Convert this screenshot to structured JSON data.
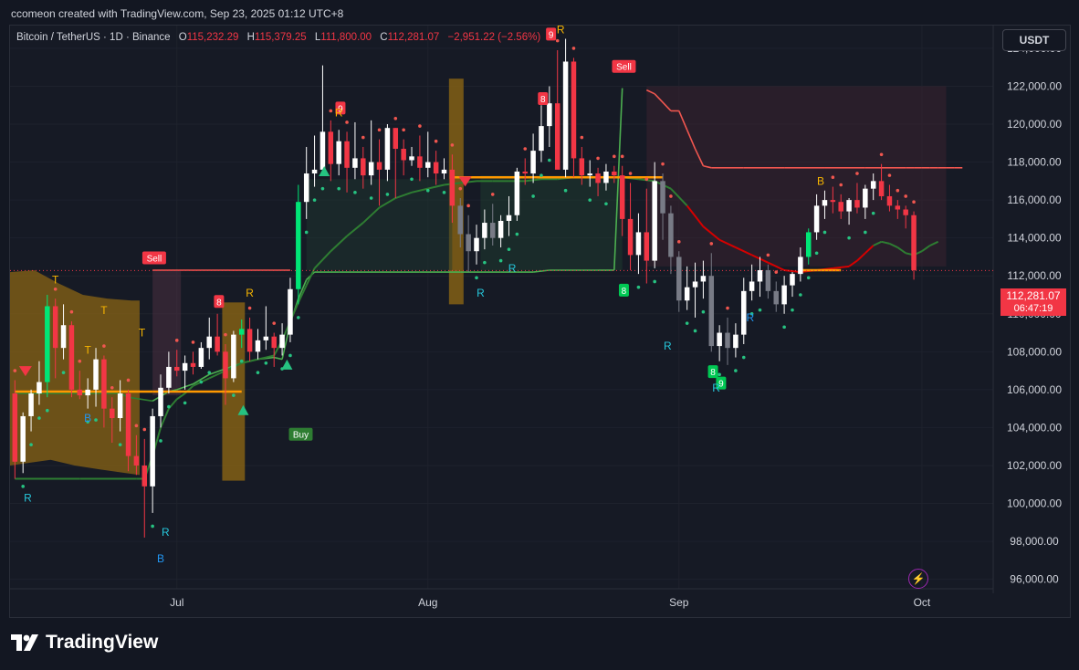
{
  "header": {
    "caption": "ccomeon created with TradingView.com, Sep 23, 2025 01:12 UTC+8",
    "symbol_line": "Bitcoin / TetherUS · 1D · Binance",
    "ohlc": {
      "o_label": "O",
      "o": "115,232.29",
      "h_label": "H",
      "h": "115,379.25",
      "l_label": "L",
      "l": "111,800.00",
      "c_label": "C",
      "c": "112,281.07",
      "change": "−2,951.22 (−2.56%)"
    }
  },
  "currency_button": "USDT",
  "last_price": {
    "price": "112,281.07",
    "countdown": "06:47:19"
  },
  "brand": {
    "name": "TradingView"
  },
  "colors": {
    "up": "#ffffff",
    "up_strong": "#00e676",
    "down": "#f23645",
    "gray": "#787b86",
    "trend_up": "#2e7d32",
    "trend_down": "#d50000",
    "orange": "#ff9800",
    "band": "#8a6414"
  },
  "chart_data": {
    "type": "candlestick",
    "symbol": "Bitcoin / TetherUS",
    "interval": "1D",
    "exchange": "Binance",
    "y_axis": {
      "ticks": [
        "96,000.00",
        "98,000.00",
        "100,000.00",
        "102,000.00",
        "104,000.00",
        "106,000.00",
        "108,000.00",
        "110,000.00",
        "112,000.00",
        "114,000.00",
        "116,000.00",
        "118,000.00",
        "120,000.00",
        "122,000.00",
        "124,000.00"
      ],
      "tick_values": [
        96000,
        98000,
        100000,
        102000,
        104000,
        106000,
        108000,
        110000,
        112000,
        114000,
        116000,
        118000,
        120000,
        122000,
        124000
      ],
      "range": [
        95500,
        125200
      ]
    },
    "x_axis": {
      "labels": [
        "Jul",
        "Aug",
        "Sep",
        "Oct"
      ],
      "label_index": [
        20,
        51,
        82,
        112
      ],
      "range": [
        -0.6,
        120.8
      ]
    },
    "candles": [
      [
        105800,
        106500,
        101300,
        102200
      ],
      [
        102200,
        104800,
        101600,
        104600
      ],
      [
        104600,
        106000,
        103800,
        105800
      ],
      [
        105800,
        107500,
        105200,
        106400
      ],
      [
        106400,
        111000,
        105600,
        110400
      ],
      [
        110400,
        110800,
        106600,
        108200
      ],
      [
        108200,
        110500,
        107600,
        109400
      ],
      [
        109400,
        109600,
        105600,
        106000
      ],
      [
        106000,
        107000,
        105500,
        105700
      ],
      [
        105700,
        106600,
        105000,
        106000
      ],
      [
        106000,
        108200,
        105100,
        107600
      ],
      [
        107600,
        107800,
        104000,
        105000
      ],
      [
        105000,
        105600,
        103200,
        104500
      ],
      [
        104500,
        106500,
        103800,
        105800
      ],
      [
        105800,
        106000,
        101700,
        102500
      ],
      [
        102500,
        103600,
        101500,
        102000
      ],
      [
        102000,
        103400,
        98200,
        100900
      ],
      [
        100900,
        105000,
        99500,
        104600
      ],
      [
        104600,
        106800,
        104000,
        106100
      ],
      [
        106100,
        108000,
        105800,
        107200
      ],
      [
        107200,
        108100,
        106700,
        107000
      ],
      [
        107000,
        107800,
        106000,
        107400
      ],
      [
        107400,
        108000,
        106800,
        107200
      ],
      [
        107200,
        108500,
        107100,
        108200
      ],
      [
        108200,
        109800,
        107600,
        108800
      ],
      [
        108800,
        110000,
        107800,
        108000
      ],
      [
        108000,
        108400,
        105200,
        106600
      ],
      [
        106600,
        109100,
        106400,
        108900
      ],
      [
        108900,
        109700,
        108200,
        109200
      ],
      [
        109200,
        109800,
        107500,
        108000
      ],
      [
        108000,
        109200,
        107600,
        108600
      ],
      [
        108600,
        110400,
        108100,
        108800
      ],
      [
        108800,
        109000,
        107200,
        108200
      ],
      [
        108200,
        109500,
        107800,
        108900
      ],
      [
        108900,
        111900,
        108500,
        111300
      ],
      [
        111300,
        116800,
        110500,
        115900
      ],
      [
        115900,
        118800,
        115000,
        117400
      ],
      [
        117400,
        119400,
        116700,
        117600
      ],
      [
        117600,
        123100,
        117300,
        119600
      ],
      [
        119600,
        120200,
        117000,
        117900
      ],
      [
        117900,
        119700,
        117300,
        119100
      ],
      [
        119100,
        119600,
        116400,
        117700
      ],
      [
        117700,
        120100,
        117100,
        118200
      ],
      [
        118200,
        118800,
        116600,
        117300
      ],
      [
        117300,
        120200,
        116800,
        118000
      ],
      [
        118000,
        119200,
        115700,
        117600
      ],
      [
        117600,
        120000,
        117000,
        119800
      ],
      [
        119800,
        119800,
        116100,
        118700
      ],
      [
        118700,
        119200,
        117300,
        118100
      ],
      [
        118100,
        118800,
        117800,
        118300
      ],
      [
        118300,
        119400,
        117000,
        117700
      ],
      [
        117700,
        119600,
        117200,
        118000
      ],
      [
        118000,
        118600,
        116800,
        117400
      ],
      [
        117400,
        118200,
        117100,
        117600
      ],
      [
        117600,
        118400,
        114800,
        115700
      ],
      [
        115700,
        116100,
        113500,
        114200
      ],
      [
        114200,
        115200,
        112200,
        113300
      ],
      [
        113300,
        114700,
        112600,
        114000
      ],
      [
        114000,
        115500,
        113400,
        114800
      ],
      [
        114800,
        115800,
        113600,
        114000
      ],
      [
        114000,
        115200,
        113500,
        114900
      ],
      [
        114900,
        116200,
        114100,
        115200
      ],
      [
        115200,
        117700,
        114900,
        117500
      ],
      [
        117500,
        118200,
        116800,
        117400
      ],
      [
        117400,
        119500,
        116900,
        118600
      ],
      [
        118600,
        121000,
        118000,
        119900
      ],
      [
        119900,
        122000,
        118800,
        121100
      ],
      [
        121100,
        123900,
        117900,
        117600
      ],
      [
        117600,
        124500,
        117200,
        123300
      ],
      [
        123300,
        123500,
        117200,
        118200
      ],
      [
        118200,
        118800,
        116800,
        117300
      ],
      [
        117300,
        118100,
        116700,
        117400
      ],
      [
        117400,
        117700,
        116200,
        116900
      ],
      [
        116900,
        117900,
        116500,
        117500
      ],
      [
        117500,
        117800,
        116900,
        117300
      ],
      [
        117300,
        117800,
        114100,
        115000
      ],
      [
        115000,
        116900,
        112300,
        113100
      ],
      [
        113100,
        115300,
        112100,
        114300
      ],
      [
        114300,
        116600,
        111600,
        112800
      ],
      [
        112800,
        118000,
        112400,
        117000
      ],
      [
        117000,
        117400,
        113900,
        115300
      ],
      [
        115300,
        115700,
        112100,
        113000
      ],
      [
        113000,
        113300,
        110100,
        110700
      ],
      [
        110700,
        112500,
        110200,
        111400
      ],
      [
        111400,
        112700,
        109800,
        111700
      ],
      [
        111700,
        112800,
        110800,
        112000
      ],
      [
        112000,
        113200,
        108000,
        108300
      ],
      [
        108300,
        109400,
        107500,
        109000
      ],
      [
        109000,
        109800,
        107300,
        108200
      ],
      [
        108200,
        109500,
        107700,
        108900
      ],
      [
        108900,
        111900,
        108400,
        111200
      ],
      [
        111200,
        112600,
        110700,
        111700
      ],
      [
        111700,
        113000,
        110900,
        112300
      ],
      [
        112300,
        112600,
        110800,
        111200
      ],
      [
        111200,
        111700,
        110100,
        110500
      ],
      [
        110500,
        112000,
        110000,
        111500
      ],
      [
        111500,
        112200,
        110900,
        112100
      ],
      [
        112100,
        113500,
        111700,
        113000
      ],
      [
        113000,
        114500,
        112600,
        114300
      ],
      [
        114300,
        116300,
        113900,
        115700
      ],
      [
        115700,
        116500,
        115000,
        116000
      ],
      [
        116000,
        116700,
        115300,
        115900
      ],
      [
        115900,
        116300,
        115000,
        115400
      ],
      [
        115400,
        116100,
        114700,
        116000
      ],
      [
        116000,
        116900,
        115300,
        115600
      ],
      [
        115600,
        116800,
        115000,
        116600
      ],
      [
        116600,
        117400,
        116000,
        117000
      ],
      [
        117000,
        117900,
        116000,
        116200
      ],
      [
        116200,
        116800,
        115400,
        115700
      ],
      [
        115700,
        116000,
        115000,
        115500
      ],
      [
        115500,
        115700,
        114500,
        115200
      ],
      [
        115200,
        115400,
        111800,
        112300
      ]
    ],
    "supertrend": [
      [
        0,
        105800
      ],
      [
        3,
        105800
      ],
      [
        12,
        105800
      ],
      [
        13,
        105800
      ],
      [
        14,
        105600
      ],
      [
        17,
        105400
      ],
      [
        19,
        105900
      ],
      [
        20,
        106000
      ],
      [
        22,
        106300
      ],
      [
        24,
        106800
      ],
      [
        26,
        107100
      ],
      [
        28,
        107400
      ],
      [
        30,
        107600
      ],
      [
        32,
        107700
      ],
      [
        33,
        107600
      ],
      [
        34,
        109500
      ],
      [
        35,
        110800
      ],
      [
        36,
        111800
      ],
      [
        37,
        112200
      ],
      [
        40,
        112200
      ],
      [
        45,
        112200
      ],
      [
        50,
        112200
      ],
      [
        55,
        112200
      ],
      [
        60,
        112200
      ],
      [
        62,
        112200
      ],
      [
        64,
        112200
      ],
      [
        66,
        112300
      ],
      [
        70,
        112300
      ],
      [
        72,
        112300
      ],
      [
        73,
        112300
      ],
      [
        74,
        112300
      ],
      [
        75,
        121900
      ],
      [
        78,
        121800
      ],
      [
        79,
        121600
      ],
      [
        81,
        120700
      ],
      [
        82,
        120700
      ],
      [
        83,
        119700
      ],
      [
        84,
        118700
      ],
      [
        85,
        117800
      ],
      [
        86,
        117700
      ],
      [
        90,
        117700
      ],
      [
        95,
        117700
      ],
      [
        100,
        117700
      ],
      [
        105,
        117700
      ],
      [
        110,
        117700
      ],
      [
        111,
        117700
      ],
      [
        112,
        117700
      ],
      [
        113,
        117700
      ],
      [
        114,
        117700
      ],
      [
        115,
        117700
      ],
      [
        116,
        117700
      ],
      [
        117,
        117700
      ]
    ],
    "trend_line": [
      [
        0,
        101300
      ],
      [
        8,
        101300
      ],
      [
        15,
        101300
      ],
      [
        16,
        101300
      ],
      [
        17,
        102500
      ],
      [
        18,
        104000
      ],
      [
        19,
        105000
      ],
      [
        20,
        105500
      ],
      [
        21,
        105800
      ],
      [
        22,
        106200
      ],
      [
        24,
        106600
      ],
      [
        26,
        107000
      ],
      [
        28,
        107400
      ],
      [
        30,
        107600
      ],
      [
        31,
        107700
      ],
      [
        32,
        107800
      ],
      [
        33,
        108600
      ],
      [
        34,
        109600
      ],
      [
        35,
        110600
      ],
      [
        36,
        111500
      ],
      [
        37,
        112400
      ],
      [
        39,
        113300
      ],
      [
        41,
        114100
      ],
      [
        43,
        114800
      ],
      [
        45,
        115600
      ],
      [
        47,
        116100
      ],
      [
        49,
        116400
      ],
      [
        51,
        116600
      ],
      [
        53,
        116800
      ],
      [
        55,
        116900
      ],
      [
        57,
        117000
      ],
      [
        59,
        117000
      ],
      [
        61,
        117000
      ],
      [
        63,
        117000
      ],
      [
        65,
        117100
      ],
      [
        67,
        117100
      ],
      [
        69,
        117200
      ],
      [
        71,
        117200
      ],
      [
        73,
        117200
      ],
      [
        75,
        117200
      ],
      [
        77,
        117100
      ],
      [
        79,
        117000
      ],
      [
        81,
        116600
      ],
      [
        83,
        115700
      ],
      [
        85,
        114600
      ],
      [
        87,
        113900
      ],
      [
        89,
        113500
      ],
      [
        91,
        113100
      ],
      [
        93,
        112700
      ],
      [
        95,
        112300
      ],
      [
        97,
        112200
      ],
      [
        99,
        112300
      ],
      [
        101,
        112400
      ],
      [
        103,
        112500
      ],
      [
        104,
        112800
      ],
      [
        105,
        113200
      ],
      [
        106,
        113600
      ],
      [
        107,
        113800
      ],
      [
        108,
        113700
      ],
      [
        109,
        113500
      ],
      [
        110,
        113200
      ],
      [
        111,
        113100
      ],
      [
        112,
        113300
      ],
      [
        113,
        113600
      ],
      [
        114,
        113800
      ]
    ],
    "buy_label": "Buy",
    "sell_labels": [
      "Sell",
      "Sell"
    ],
    "count_labels": [
      "8",
      "9",
      "8",
      "9",
      "8",
      "8",
      "9"
    ],
    "letter_labels": [
      "T",
      "T",
      "T",
      "T",
      "B",
      "R",
      "R",
      "B",
      "R",
      "R",
      "R",
      "R",
      "R",
      "R",
      "B",
      "R",
      "R"
    ],
    "last_price_line": 112281.07
  }
}
